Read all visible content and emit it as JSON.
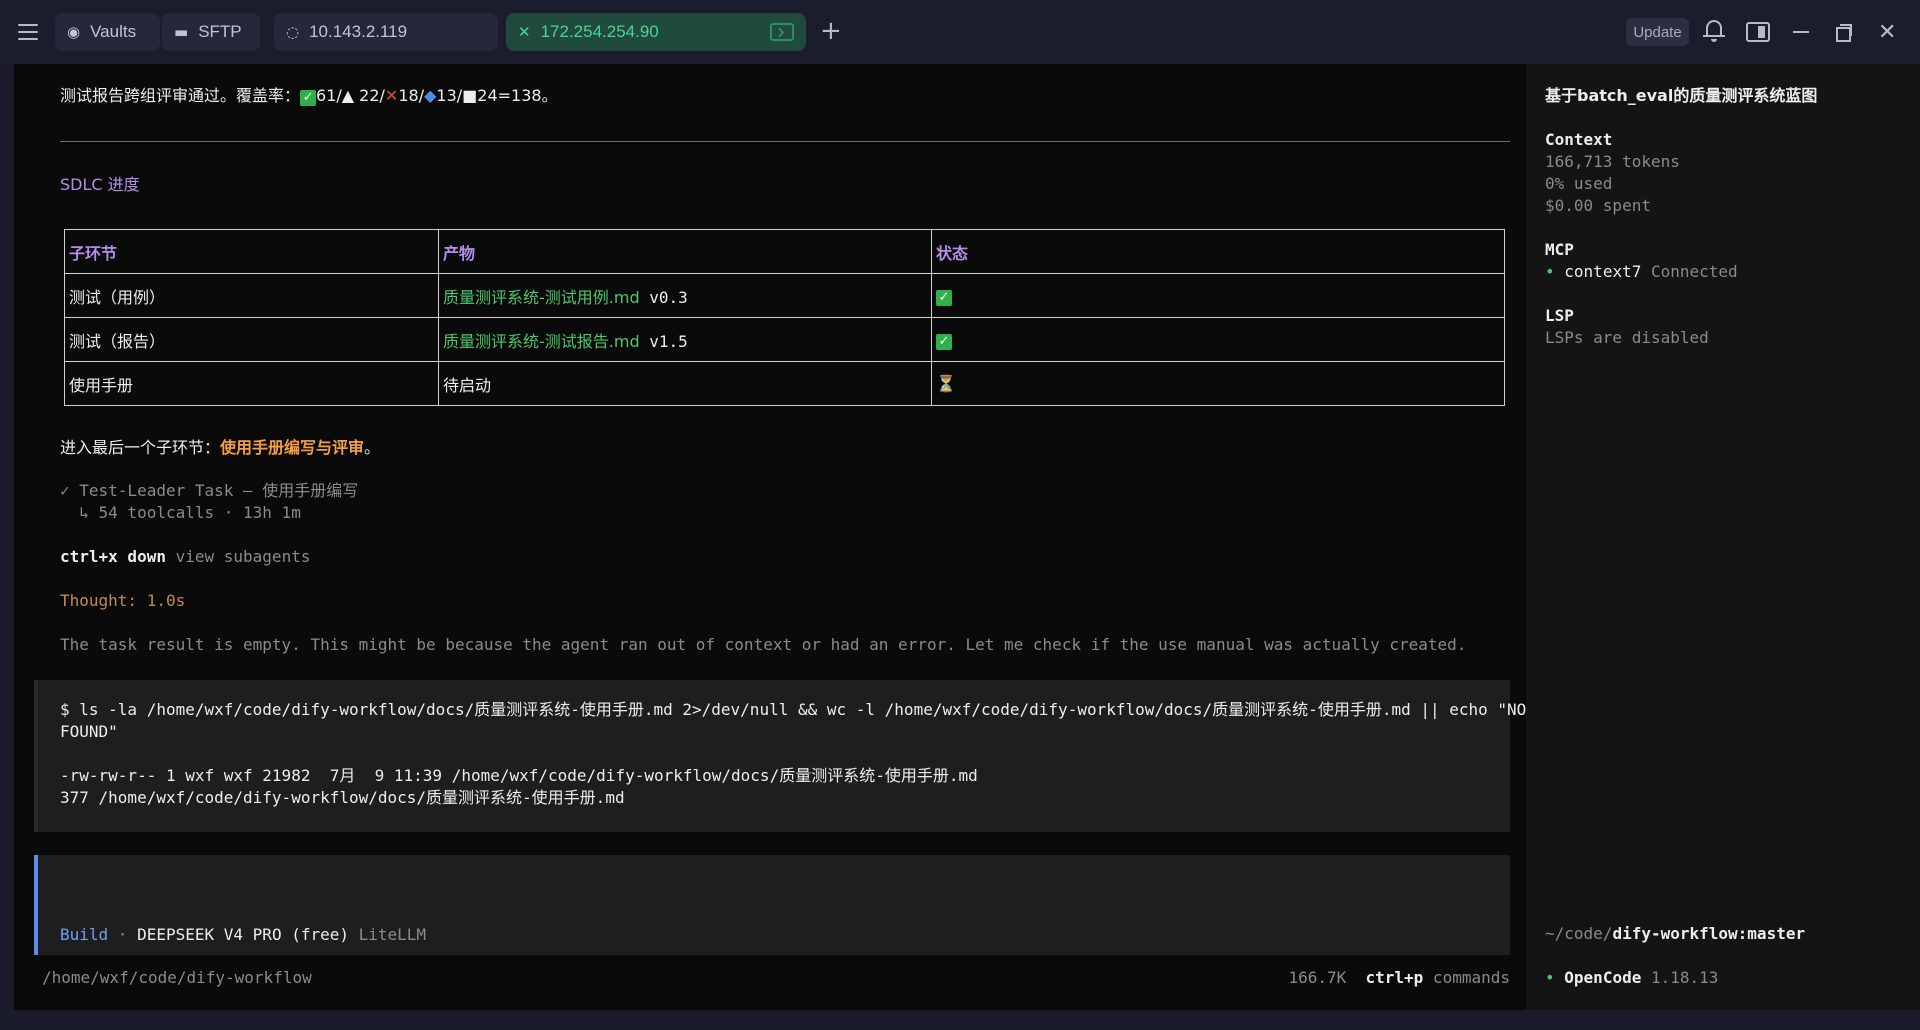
{
  "topbar": {
    "tabs": [
      {
        "icon": "eye-icon",
        "label": "Vaults"
      },
      {
        "icon": "folder-icon",
        "label": "SFTP"
      },
      {
        "icon": "loading-icon",
        "label": "10.143.2.119"
      },
      {
        "icon": "close-icon",
        "label": "172.254.254.90"
      }
    ],
    "update_label": "Update"
  },
  "main": {
    "summary_prefix": "测试报告跨组评审通过。覆盖率：",
    "coverage": {
      "ok": "61",
      "warn": "22",
      "fail": "18",
      "info": "13",
      "other": "24",
      "total": "=138。"
    },
    "sdlc_title": "SDLC 进度",
    "table": {
      "headers": [
        "子环节",
        "产物",
        "状态"
      ],
      "rows": [
        {
          "stage": "测试（用例）",
          "artifact_link": "质量测评系统-测试用例.md",
          "artifact_version": " v0.3",
          "status": "done"
        },
        {
          "stage": "测试（报告）",
          "artifact_link": "质量测评系统-测试报告.md",
          "artifact_version": " v1.5",
          "status": "done"
        },
        {
          "stage": "使用手册",
          "artifact_link": "",
          "artifact_version": "待启动",
          "status": "pending"
        }
      ]
    },
    "next_prefix": "进入最后一个子环节：",
    "next_highlight": "使用手册编写与评审",
    "next_suffix": "。",
    "task_line": "✓ Test-Leader Task — 使用手册编写",
    "task_sub": "  ↳ 54 toolcalls · 13h 1m",
    "shortcut_key": "ctrl+x down",
    "shortcut_desc": " view subagents",
    "thought": "Thought: 1.0s",
    "message": "The task result is empty. This might be because the agent ran out of context or had an error. Let me check if the use manual was actually created.",
    "command_line1": "$ ls -la /home/wxf/code/dify-workflow/docs/质量测评系统-使用手册.md 2>/dev/null && wc -l /home/wxf/code/dify-workflow/docs/质量测评系统-使用手册.md || echo \"NOT",
    "command_line2": "FOUND\"",
    "output_line1": "-rw-rw-r-- 1 wxf wxf 21982  7月  9 11:39 /home/wxf/code/dify-workflow/docs/质量测评系统-使用手册.md",
    "output_line2": "377 /home/wxf/code/dify-workflow/docs/质量测评系统-使用手册.md",
    "prompt": {
      "mode": "Build",
      "sep": " · ",
      "model": "DEEPSEEK V4 PRO (free)",
      "provider": " LiteLLM"
    },
    "status_path": "/home/wxf/code/dify-workflow",
    "status_tokens": "166.7K",
    "status_key": "ctrl+p",
    "status_cmd": " commands"
  },
  "sidebar": {
    "title": "基于batch_eval的质量测评系统蓝图",
    "context_label": "Context",
    "context_tokens": "166,713 tokens",
    "context_used": "0% used",
    "context_spent": "$0.00 spent",
    "mcp_label": "MCP",
    "mcp_name": "context7",
    "mcp_status": " Connected",
    "lsp_label": "LSP",
    "lsp_status": "LSPs are disabled",
    "cwd_prefix": "~/code/",
    "cwd_repo": "dify-workflow:master",
    "app_name_a": "Open",
    "app_name_b": "Code",
    "app_version": " 1.18.13"
  }
}
